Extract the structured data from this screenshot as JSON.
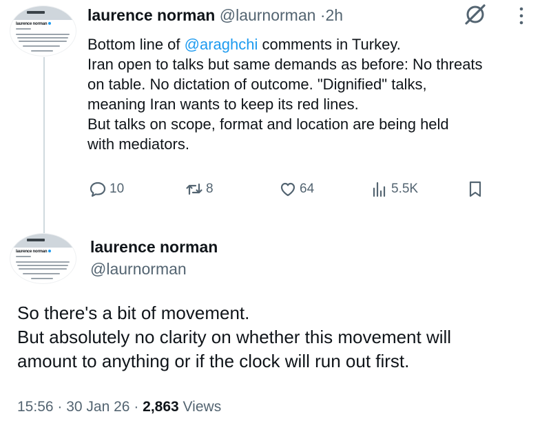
{
  "tweet1": {
    "author_name": "laurence norman",
    "author_handle": "@laurnorman",
    "separator": "·",
    "time": "2h",
    "body": {
      "line1_prefix": "Bottom line of ",
      "line1_mention": "@araghchi",
      "line1_suffix": " comments in Turkey.",
      "line2": "Iran open to talks but same demands as before: No threats",
      "line3": "on table. No dictation of outcome. \"Dignified\" talks,",
      "line4": "meaning Iran wants to keep its red lines.",
      "line5": "But talks on scope, format and location are being held",
      "line6": "with mediators."
    },
    "actions": {
      "replies": "10",
      "reposts": "8",
      "likes": "64",
      "views": "5.5K"
    },
    "icons": [
      "grok-icon",
      "more-icon",
      "reply-icon",
      "repost-icon",
      "like-icon",
      "views-icon",
      "bookmark-icon"
    ]
  },
  "avatar": {
    "name": "laurence norman"
  },
  "tweet2": {
    "author_name": "laurence norman",
    "author_handle": "@laurnorman",
    "body": {
      "line1": "So there's a bit of movement.",
      "line2": "But absolutely no clarity on whether this movement will",
      "line3": "amount to anything or if the clock will run out first."
    },
    "meta": {
      "time": "15:56",
      "sep1": " · ",
      "date": "30 Jan 26",
      "sep2": " · ",
      "views_count": "2,863",
      "views_label": " Views"
    }
  },
  "colors": {
    "text": "#0f1419",
    "secondary": "#536471",
    "link": "#1d9bf0",
    "thread_line": "#cfd9de"
  }
}
